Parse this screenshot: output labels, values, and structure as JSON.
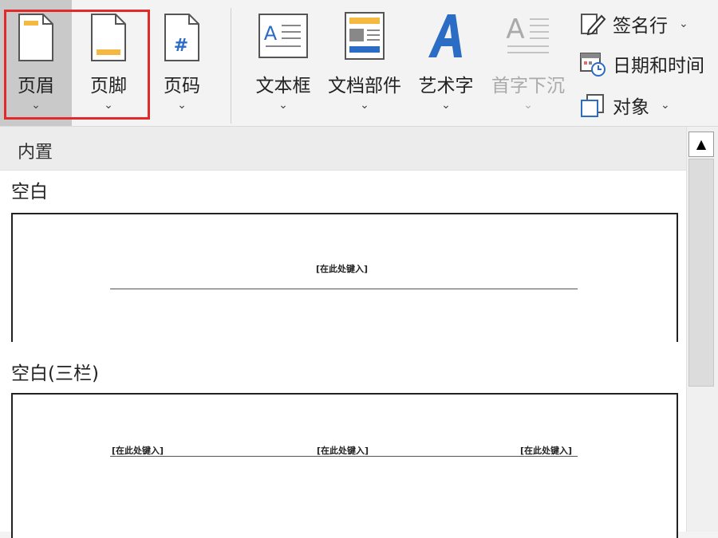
{
  "ribbon": {
    "buttons": [
      {
        "label": "页眉",
        "chevron": "⌄"
      },
      {
        "label": "页脚",
        "chevron": "⌄"
      },
      {
        "label": "页码",
        "chevron": "⌄",
        "icon_text": "#"
      },
      {
        "label": "文本框",
        "chevron": "⌄"
      },
      {
        "label": "文档部件",
        "chevron": "⌄"
      },
      {
        "label": "艺术字",
        "chevron": "⌄"
      },
      {
        "label": "首字下沉",
        "chevron": "⌄"
      }
    ],
    "small_buttons": [
      {
        "label": "签名行",
        "chevron": "⌄"
      },
      {
        "label": "日期和时间"
      },
      {
        "label": "对象",
        "chevron": "⌄"
      }
    ],
    "highlight_color": "#e32a2a",
    "accent_orange": "#f5b942",
    "accent_blue": "#2b6cc4"
  },
  "gallery": {
    "category": "内置",
    "items": [
      {
        "title": "空白",
        "placeholders": [
          "[在此处键入]"
        ]
      },
      {
        "title": "空白(三栏)",
        "placeholders": [
          "[在此处键入]",
          "[在此处键入]",
          "[在此处键入]"
        ]
      }
    ]
  },
  "scrollbar": {
    "up_arrow": "▲"
  }
}
